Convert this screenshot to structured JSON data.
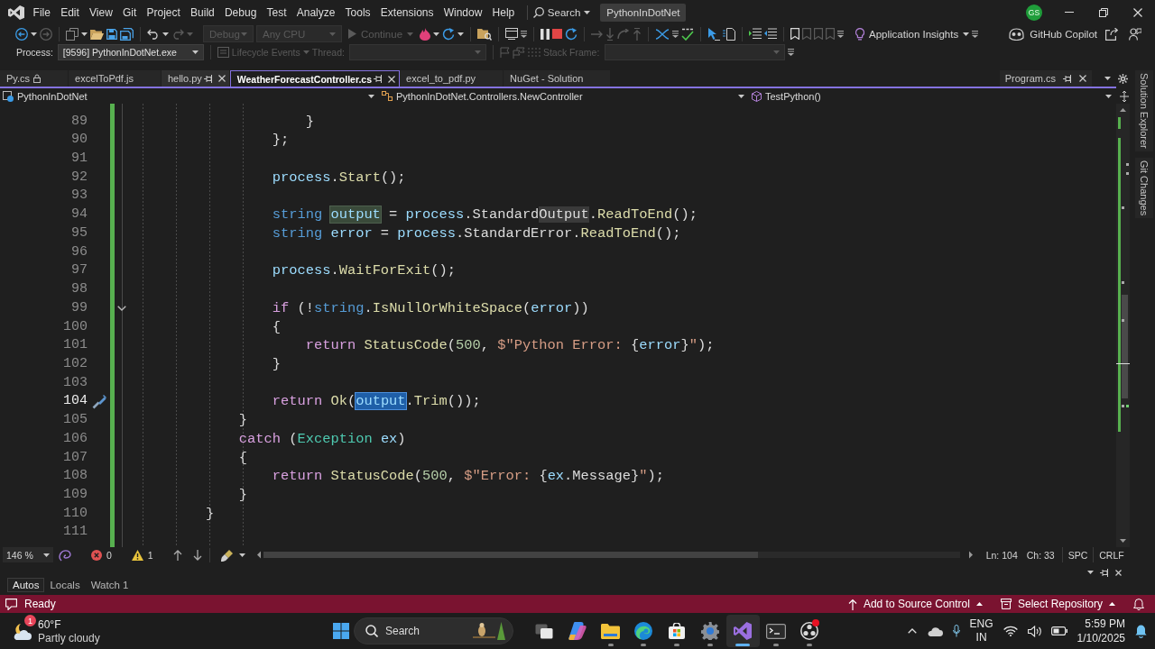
{
  "menu_bar": {
    "items": [
      "File",
      "Edit",
      "View",
      "Git",
      "Project",
      "Build",
      "Debug",
      "Test",
      "Analyze",
      "Tools",
      "Extensions",
      "Window",
      "Help"
    ],
    "search": "Search",
    "solution": "PythonInDotNet",
    "account": "GS"
  },
  "toolbar": {
    "configuration": {
      "value": "Debug",
      "disabled": true
    },
    "platform": {
      "value": "Any CPU",
      "disabled": true
    },
    "continue": {
      "label": "Continue",
      "disabled": true
    },
    "insights": "Application Insights",
    "copilot": "GitHub Copilot"
  },
  "debug_location": {
    "process": {
      "label": "Process:",
      "value": "[9596] PythonInDotNet.exe",
      "disabled": false
    },
    "lifecycle_events": {
      "label": "Lifecycle Events",
      "disabled": true
    },
    "thread": {
      "label": "Thread:",
      "disabled": true
    },
    "stack_frame": {
      "label": "Stack Frame:",
      "disabled": true
    }
  },
  "document_tabs": [
    {
      "label": "Py.cs",
      "selected": false,
      "hovered": false,
      "locked": true
    },
    {
      "label": "excelToPdf.js",
      "selected": false,
      "hovered": false,
      "locked": false
    },
    {
      "label": "hello.py",
      "selected": false,
      "hovered": true,
      "locked": false
    },
    {
      "label": "WeatherForecastController.cs",
      "selected": true,
      "hovered": false,
      "locked": false
    },
    {
      "label": "excel_to_pdf.py",
      "selected": false,
      "hovered": false,
      "locked": false
    },
    {
      "label": "NuGet - Solution",
      "selected": false,
      "hovered": false,
      "locked": false
    }
  ],
  "pinned_tab": {
    "label": "Program.cs"
  },
  "side_tabs": [
    "Solution Explorer",
    "Git Changes"
  ],
  "navigation_bar": {
    "project": "PythonInDotNet",
    "type": "PythonInDotNet.Controllers.NewController",
    "member": "TestPython()"
  },
  "editor": {
    "lines": [
      {
        "number": "89",
        "current": false,
        "code": [
          {
            "text": "                    }",
            "kind": "punctuation"
          }
        ]
      },
      {
        "number": "90",
        "current": false,
        "code": [
          {
            "text": "                };",
            "kind": "punctuation"
          }
        ]
      },
      {
        "number": "91",
        "current": false
      },
      {
        "number": "92",
        "current": false,
        "code": [
          {
            "text": "                process",
            "kind": "variable"
          },
          {
            "text": ".",
            "kind": "punctuation"
          },
          {
            "text": "Start",
            "kind": "method"
          },
          {
            "text": "();",
            "kind": "punctuation"
          }
        ]
      },
      {
        "number": "93",
        "current": false
      },
      {
        "number": "94",
        "current": false,
        "code": [
          {
            "text": "                string ",
            "kind": "keyword"
          },
          {
            "text": "output",
            "kind": "reference"
          },
          {
            "text": " = ",
            "kind": "punctuation"
          },
          {
            "text": "process",
            "kind": "variable"
          },
          {
            "text": ".Standard",
            "kind": "property"
          },
          {
            "text": "Output",
            "kind": "match"
          },
          {
            "text": ".",
            "kind": "punctuation"
          },
          {
            "text": "ReadToEnd",
            "kind": "method"
          },
          {
            "text": "();",
            "kind": "punctuation"
          }
        ]
      },
      {
        "number": "95",
        "current": false,
        "code": [
          {
            "text": "                string ",
            "kind": "keyword"
          },
          {
            "text": "error",
            "kind": "variable"
          },
          {
            "text": " = ",
            "kind": "punctuation"
          },
          {
            "text": "process",
            "kind": "variable"
          },
          {
            "text": ".StandardError.",
            "kind": "property"
          },
          {
            "text": "ReadToEnd",
            "kind": "method"
          },
          {
            "text": "();",
            "kind": "punctuation"
          }
        ]
      },
      {
        "number": "96",
        "current": false
      },
      {
        "number": "97",
        "current": false,
        "code": [
          {
            "text": "                process",
            "kind": "variable"
          },
          {
            "text": ".",
            "kind": "punctuation"
          },
          {
            "text": "WaitForExit",
            "kind": "method"
          },
          {
            "text": "();",
            "kind": "punctuation"
          }
        ]
      },
      {
        "number": "98",
        "current": false
      },
      {
        "number": "99",
        "current": false,
        "kind": "fold",
        "code": [
          {
            "text": "                if",
            "kind": "control"
          },
          {
            "text": " (!",
            "kind": "punctuation"
          },
          {
            "text": "string",
            "kind": "keyword"
          },
          {
            "text": ".",
            "kind": "punctuation"
          },
          {
            "text": "IsNullOrWhiteSpace",
            "kind": "method"
          },
          {
            "text": "(",
            "kind": "punctuation"
          },
          {
            "text": "error",
            "kind": "variable"
          },
          {
            "text": "))",
            "kind": "punctuation"
          }
        ]
      },
      {
        "number": "100",
        "current": false,
        "code": [
          {
            "text": "                {",
            "kind": "punctuation"
          }
        ]
      },
      {
        "number": "101",
        "current": false,
        "code": [
          {
            "text": "                    return ",
            "kind": "control"
          },
          {
            "text": "StatusCode",
            "kind": "method"
          },
          {
            "text": "(",
            "kind": "punctuation"
          },
          {
            "text": "500",
            "kind": "number"
          },
          {
            "text": ", ",
            "kind": "punctuation"
          },
          {
            "text": "$\"Python Error: ",
            "kind": "string"
          },
          {
            "text": "{",
            "kind": "punctuation"
          },
          {
            "text": "error",
            "kind": "variable"
          },
          {
            "text": "}",
            "kind": "punctuation"
          },
          {
            "text": "\"",
            "kind": "string"
          },
          {
            "text": ");",
            "kind": "punctuation"
          }
        ]
      },
      {
        "number": "102",
        "current": false,
        "code": [
          {
            "text": "                }",
            "kind": "punctuation"
          }
        ]
      },
      {
        "number": "103",
        "current": false
      },
      {
        "number": "104",
        "current": true,
        "kind": "quick-actions",
        "code": [
          {
            "text": "                return ",
            "kind": "control"
          },
          {
            "text": "Ok",
            "kind": "method"
          },
          {
            "text": "(",
            "kind": "punctuation"
          },
          {
            "text": "output",
            "kind": "selection"
          },
          {
            "text": ".",
            "kind": "punctuation"
          },
          {
            "text": "Trim",
            "kind": "method"
          },
          {
            "text": "());",
            "kind": "punctuation"
          }
        ]
      },
      {
        "number": "105",
        "current": false,
        "code": [
          {
            "text": "            }",
            "kind": "punctuation"
          }
        ]
      },
      {
        "number": "106",
        "current": false,
        "code": [
          {
            "text": "            catch",
            "kind": "control"
          },
          {
            "text": " (",
            "kind": "punctuation"
          },
          {
            "text": "Exception ",
            "kind": "type"
          },
          {
            "text": "ex",
            "kind": "variable"
          },
          {
            "text": ")",
            "kind": "punctuation"
          }
        ]
      },
      {
        "number": "107",
        "current": false,
        "code": [
          {
            "text": "            {",
            "kind": "punctuation"
          }
        ]
      },
      {
        "number": "108",
        "current": false,
        "code": [
          {
            "text": "                return ",
            "kind": "control"
          },
          {
            "text": "StatusCode",
            "kind": "method"
          },
          {
            "text": "(",
            "kind": "punctuation"
          },
          {
            "text": "500",
            "kind": "number"
          },
          {
            "text": ", ",
            "kind": "punctuation"
          },
          {
            "text": "$\"Error: ",
            "kind": "string"
          },
          {
            "text": "{",
            "kind": "punctuation"
          },
          {
            "text": "ex",
            "kind": "variable"
          },
          {
            "text": ".Message}",
            "kind": "property"
          },
          {
            "text": "\"",
            "kind": "string"
          },
          {
            "text": ");",
            "kind": "punctuation"
          }
        ]
      },
      {
        "number": "109",
        "current": false,
        "code": [
          {
            "text": "            }",
            "kind": "punctuation"
          }
        ]
      },
      {
        "number": "110",
        "current": false,
        "code": [
          {
            "text": "        }",
            "kind": "punctuation"
          }
        ]
      },
      {
        "number": "111",
        "current": false
      }
    ]
  },
  "editor_status": {
    "zoom": "146 %",
    "errors": "0",
    "warnings": "1",
    "line": "Ln: 104",
    "column": "Ch: 33",
    "indentation": "SPC",
    "line_ending": "CRLF"
  },
  "tool_window_tabs": [
    {
      "label": "Autos",
      "selected": true
    },
    {
      "label": "Locals",
      "selected": false
    },
    {
      "label": "Watch 1",
      "selected": false
    }
  ],
  "status_bar": {
    "message": "Ready",
    "source_control": "Add to Source Control",
    "repository": "Select Repository"
  },
  "taskbar": {
    "weather": {
      "badge": "1",
      "temperature": "60°F",
      "condition": "Partly cloudy"
    },
    "search": {
      "placeholder": "Search"
    },
    "apps": [
      {
        "kind": "task-view",
        "running": false,
        "active": false,
        "notification": false
      },
      {
        "kind": "assistant",
        "running": false,
        "active": false,
        "notification": false
      },
      {
        "kind": "files",
        "running": true,
        "active": false,
        "notification": false
      },
      {
        "kind": "browser",
        "running": true,
        "active": false,
        "notification": false
      },
      {
        "kind": "store",
        "running": true,
        "active": false,
        "notification": false
      },
      {
        "kind": "settings",
        "running": true,
        "active": false,
        "notification": false
      },
      {
        "kind": "ide",
        "running": true,
        "active": true,
        "notification": false
      },
      {
        "kind": "terminal",
        "running": true,
        "active": false,
        "notification": false
      },
      {
        "kind": "recorder",
        "running": true,
        "active": false,
        "notification": true
      }
    ],
    "language": [
      "ENG",
      "IN"
    ],
    "time": "5:59 PM",
    "date": "1/10/2025"
  }
}
